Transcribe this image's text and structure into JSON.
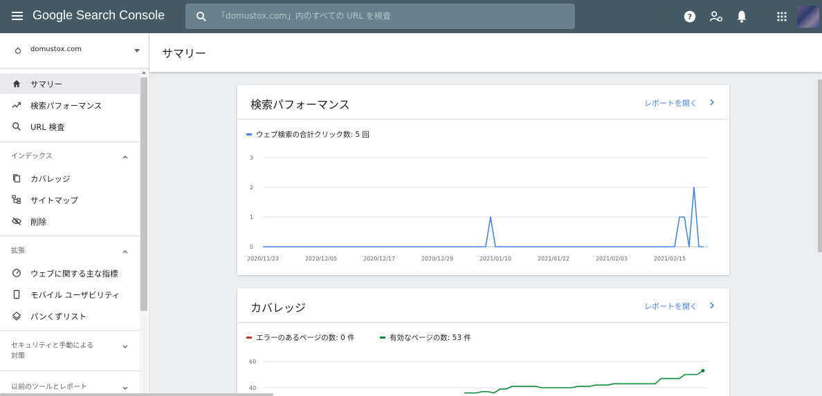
{
  "app": {
    "brand": "Google Search Console",
    "search_placeholder": "「domustox.com」内のすべての URL を検査"
  },
  "topbar_icons": [
    "help-icon",
    "manage-users-icon",
    "notifications-icon",
    "apps-grid-icon"
  ],
  "property": {
    "name": "domustox.com"
  },
  "page": {
    "title": "サマリー"
  },
  "sidebar": {
    "items": [
      {
        "label": "サマリー",
        "icon": "home-icon",
        "active": true
      },
      {
        "label": "検索パフォーマンス",
        "icon": "trending-icon"
      },
      {
        "label": "URL 検査",
        "icon": "search-icon"
      }
    ],
    "sections": [
      {
        "label": "インデックス",
        "expanded": true,
        "items": [
          {
            "label": "カバレッジ",
            "icon": "copy-icon"
          },
          {
            "label": "サイトマップ",
            "icon": "sitemap-icon"
          },
          {
            "label": "削除",
            "icon": "hidden-icon"
          }
        ]
      },
      {
        "label": "拡張",
        "expanded": true,
        "items": [
          {
            "label": "ウェブに関する主な指標",
            "icon": "speed-gauge-icon"
          },
          {
            "label": "モバイル ユーザビリティ",
            "icon": "mobile-icon"
          },
          {
            "label": "パンくずリスト",
            "icon": "layers-icon"
          }
        ]
      },
      {
        "label_line1": "セキュリティと手動による",
        "label_line2": "対策",
        "expanded": false
      },
      {
        "label": "以前のツールとレポート",
        "expanded": false
      }
    ]
  },
  "cards": {
    "performance": {
      "title": "検索パフォーマンス",
      "link": "レポートを開く",
      "legend": "ウェブ検索の合計クリック数: 5 回",
      "color": "#4285f4"
    },
    "coverage": {
      "title": "カバレッジ",
      "link": "レポートを開く",
      "legend_error": "エラーのあるページの数: 0 件",
      "legend_valid": "有効なページの数: 53 件",
      "color_error": "#d93025",
      "color_valid": "#0d8a3e"
    }
  },
  "chart_data": [
    {
      "type": "line",
      "x_tick_labels": [
        "2020/11/23",
        "2020/12/05",
        "2020/12/17",
        "2020/12/29",
        "2021/01/10",
        "2021/01/22",
        "2021/02/03",
        "2021/02/15"
      ],
      "ylim": [
        0,
        3
      ],
      "y_ticks": [
        0,
        1,
        2,
        3
      ],
      "grid": true,
      "legend_position": "top-left",
      "series": [
        {
          "name": "ウェブ検索の合計クリック数: 5 回",
          "color": "#4285f4",
          "points": [
            {
              "x": "2020/11/23",
              "y": 0
            },
            {
              "x": "2021/01/08",
              "y": 0
            },
            {
              "x": "2021/01/09",
              "y": 1
            },
            {
              "x": "2021/01/10",
              "y": 0
            },
            {
              "x": "2021/02/16",
              "y": 0
            },
            {
              "x": "2021/02/17",
              "y": 1
            },
            {
              "x": "2021/02/18",
              "y": 1
            },
            {
              "x": "2021/02/19",
              "y": 0
            },
            {
              "x": "2021/02/20",
              "y": 2
            },
            {
              "x": "2021/02/21",
              "y": 0
            },
            {
              "x": "2021/02/22",
              "y": 0
            }
          ]
        }
      ]
    },
    {
      "type": "line",
      "y_ticks": [
        40,
        60
      ],
      "grid": true,
      "legend_position": "top-left",
      "series": [
        {
          "name": "エラーのあるページの数: 0 件",
          "color": "#d93025",
          "values": [
            0
          ]
        },
        {
          "name": "有効なページの数: 53 件",
          "color": "#0d8a3e",
          "values": [
            36,
            36,
            36,
            37,
            37,
            36,
            39,
            39,
            41,
            41,
            41,
            41,
            41,
            40,
            40,
            40,
            40,
            40,
            40,
            41,
            41,
            41,
            42,
            42,
            42,
            43,
            43,
            43,
            43,
            43,
            43,
            43,
            43,
            47,
            47,
            47,
            47,
            50,
            50,
            50,
            53
          ]
        }
      ]
    }
  ]
}
